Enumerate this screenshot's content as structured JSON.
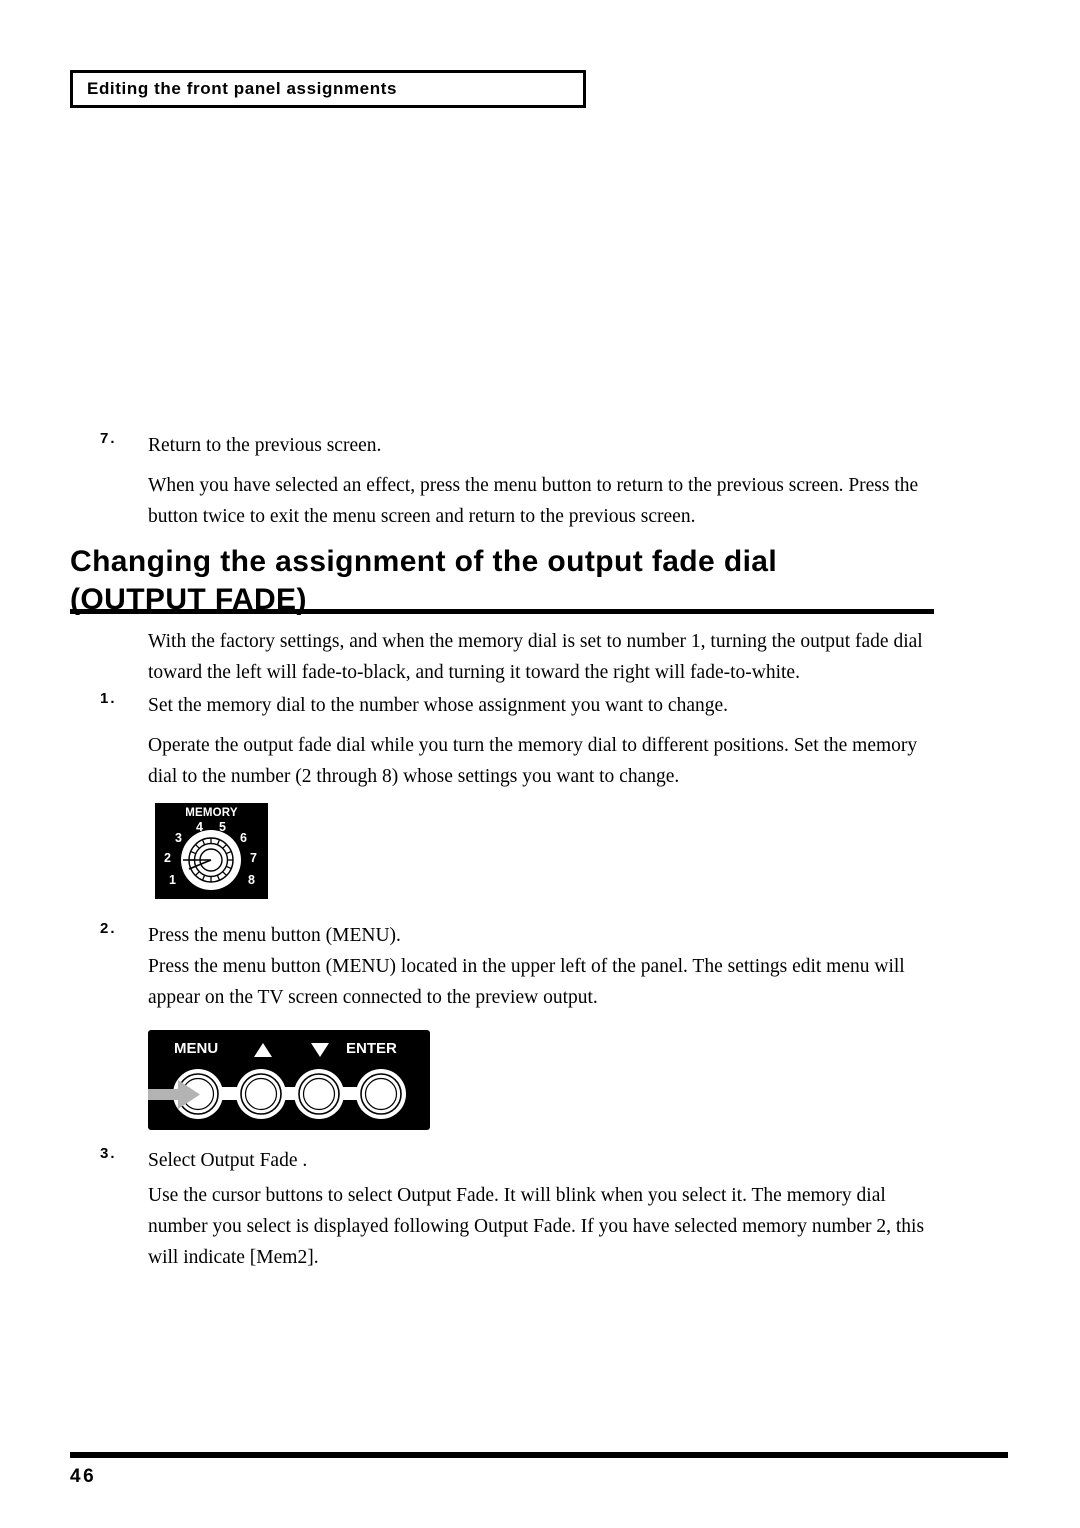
{
  "page": {
    "running_header": "Editing the front panel assignments",
    "page_number": "46"
  },
  "steps": [
    {
      "number": "7.",
      "title": "Return to the previous screen.",
      "body": "When you have selected an effect, press the menu button to return to the previous screen. Press the button twice to exit the menu screen and return to the previous screen."
    },
    {
      "number": "1.",
      "title": "Set the memory dial to the number whose assignment you want to change.",
      "body": "Operate the output fade dial while you turn the memory dial to different positions. Set the memory dial to the number (2 through 8) whose settings you want to change."
    },
    {
      "number": "2.",
      "title": "Press the menu button (MENU).",
      "body": "Press the menu button (MENU) located in the upper left of the panel. The settings edit menu will appear on the TV screen connected to the preview output."
    },
    {
      "number": "3.",
      "title": "Select  Output Fade .",
      "body": "Use the cursor buttons to select  Output Fade.  It will blink when you select it. The memory dial number you select is displayed following  Output Fade.  If you have selected memory number 2, this will indicate [Mem2]."
    }
  ],
  "section": {
    "heading_line1": "Changing the assignment of the output fade dial",
    "heading_line2": "(OUTPUT FADE)",
    "intro": "With the factory settings, and when the memory dial is set to number 1, turning the output fade dial toward the left will fade-to-black, and turning it toward the right will fade-to-white."
  },
  "figures": {
    "memory_dial": {
      "label": "MEMORY",
      "positions": [
        "1",
        "2",
        "3",
        "4",
        "5",
        "6",
        "7",
        "8"
      ]
    },
    "menu_panel": {
      "menu_label": "MENU",
      "up_label": "▲",
      "down_label": "▼",
      "enter_label": "ENTER"
    }
  },
  "colors": {
    "ink": "#000000",
    "paper": "#ffffff",
    "panel_bg": "#000000",
    "panel_fg": "#ffffff",
    "arrow_gray": "#b3b3b3"
  }
}
